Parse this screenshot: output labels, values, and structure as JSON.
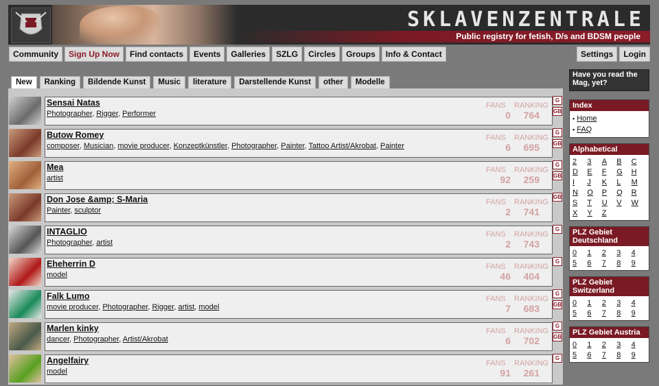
{
  "header": {
    "title": "SKLAVENZENTRALE",
    "subtitle": "Public registry for fetish, D/s and BDSM people"
  },
  "nav_left": [
    {
      "label": "Community",
      "highlight": false
    },
    {
      "label": "Sign Up Now",
      "highlight": true
    },
    {
      "label": "Find contacts",
      "highlight": false
    },
    {
      "label": "Events",
      "highlight": false
    },
    {
      "label": "Galleries",
      "highlight": false
    },
    {
      "label": "SZLG",
      "highlight": false
    },
    {
      "label": "Circles",
      "highlight": false
    },
    {
      "label": "Groups",
      "highlight": false
    },
    {
      "label": "Info & Contact",
      "highlight": false
    }
  ],
  "nav_right": [
    {
      "label": "Settings"
    },
    {
      "label": "Login"
    }
  ],
  "tabs": [
    {
      "label": "New",
      "active": true
    },
    {
      "label": "Ranking",
      "active": false
    },
    {
      "label": "Bildende Kunst",
      "active": false
    },
    {
      "label": "Music",
      "active": false
    },
    {
      "label": "literature",
      "active": false
    },
    {
      "label": "Darstellende Kunst",
      "active": false
    },
    {
      "label": "other",
      "active": false
    },
    {
      "label": "Modelle",
      "active": false
    }
  ],
  "stat_labels": {
    "fans": "FANS",
    "ranking": "RANKING"
  },
  "rows": [
    {
      "name": "Sensai Natas",
      "tags": [
        "Photographer",
        "Rigger",
        "Performer"
      ],
      "fans": "0",
      "ranking": "764",
      "badges": [
        "G",
        "GB"
      ],
      "thumb": [
        "#6b6b6b",
        "#cfcfcf"
      ]
    },
    {
      "name": "Butow Romey",
      "tags": [
        "composer",
        "Musician",
        "movie producer",
        "Konzeptkünstler",
        "Photographer",
        "Painter",
        "Tattoo Artist/Akrobat",
        "Painter"
      ],
      "fans": "6",
      "ranking": "695",
      "badges": [
        "G",
        "GB"
      ],
      "thumb": [
        "#7a3a2a",
        "#c99a7a"
      ]
    },
    {
      "name": "Mea",
      "tags": [
        "artist"
      ],
      "fans": "92",
      "ranking": "259",
      "badges": [
        "G",
        "GB"
      ],
      "thumb": [
        "#a0603a",
        "#e0b080"
      ]
    },
    {
      "name": "Don Jose &amp; S-Maria",
      "tags": [
        "Painter",
        "sculptor"
      ],
      "fans": "2",
      "ranking": "741",
      "badges": [
        "GB"
      ],
      "thumb": [
        "#7a3a2a",
        "#c99a7a"
      ]
    },
    {
      "name": "INTAGLIO",
      "tags": [
        "Photographer",
        "artist"
      ],
      "fans": "2",
      "ranking": "743",
      "badges": [
        "G"
      ],
      "thumb": [
        "#555",
        "#d8d8d8"
      ]
    },
    {
      "name": "Eheherrin D",
      "tags": [
        "model"
      ],
      "fans": "46",
      "ranking": "404",
      "badges": [
        "G"
      ],
      "thumb": [
        "#b01818",
        "#f0d8c8"
      ]
    },
    {
      "name": "Falk Lumo",
      "tags": [
        "movie producer",
        "Photographer",
        "Rigger",
        "artist",
        "model"
      ],
      "fans": "7",
      "ranking": "683",
      "badges": [
        "G",
        "GB"
      ],
      "thumb": [
        "#1a8a5a",
        "#e8e8e8"
      ]
    },
    {
      "name": "Marlen kinky",
      "tags": [
        "dancer",
        "Photographer",
        "Artist/Akrobat"
      ],
      "fans": "6",
      "ranking": "702",
      "badges": [
        "G",
        "GB"
      ],
      "thumb": [
        "#4a5a4a",
        "#c0a880"
      ]
    },
    {
      "name": "Angelfairy",
      "tags": [
        "model"
      ],
      "fans": "91",
      "ranking": "261",
      "badges": [
        "G"
      ],
      "thumb": [
        "#5aa020",
        "#e0c0a0"
      ]
    }
  ],
  "sidebar": {
    "mag": "Have you read the Mag, yet?",
    "index": {
      "title": "Index",
      "items": [
        "Home",
        "FAQ"
      ]
    },
    "alphabetical": {
      "title": "Alphabetical",
      "items": [
        "2",
        "3",
        "A",
        "B",
        "C",
        "D",
        "E",
        "F",
        "G",
        "H",
        "I",
        "J",
        "K",
        "L",
        "M",
        "N",
        "O",
        "P",
        "Q",
        "R",
        "S",
        "T",
        "U",
        "V",
        "W",
        "X",
        "Y",
        "Z"
      ]
    },
    "plz_de": {
      "title": "PLZ Gebiet Deutschland",
      "items": [
        "0",
        "1",
        "2",
        "3",
        "4",
        "5",
        "6",
        "7",
        "8",
        "9"
      ]
    },
    "plz_ch": {
      "title": "PLZ Gebiet Switzerland",
      "items": [
        "0",
        "1",
        "2",
        "3",
        "4",
        "5",
        "6",
        "7",
        "8",
        "9"
      ]
    },
    "plz_at": {
      "title": "PLZ Gebiet Austria",
      "items": [
        "0",
        "1",
        "2",
        "3",
        "4",
        "5",
        "6",
        "7",
        "8",
        "9"
      ]
    }
  },
  "colors": {
    "accent": "#7a1a24",
    "stat": "#d3a2a2",
    "nav_bg": "#dcdcdc",
    "page_bg": "#7a7a7a"
  }
}
